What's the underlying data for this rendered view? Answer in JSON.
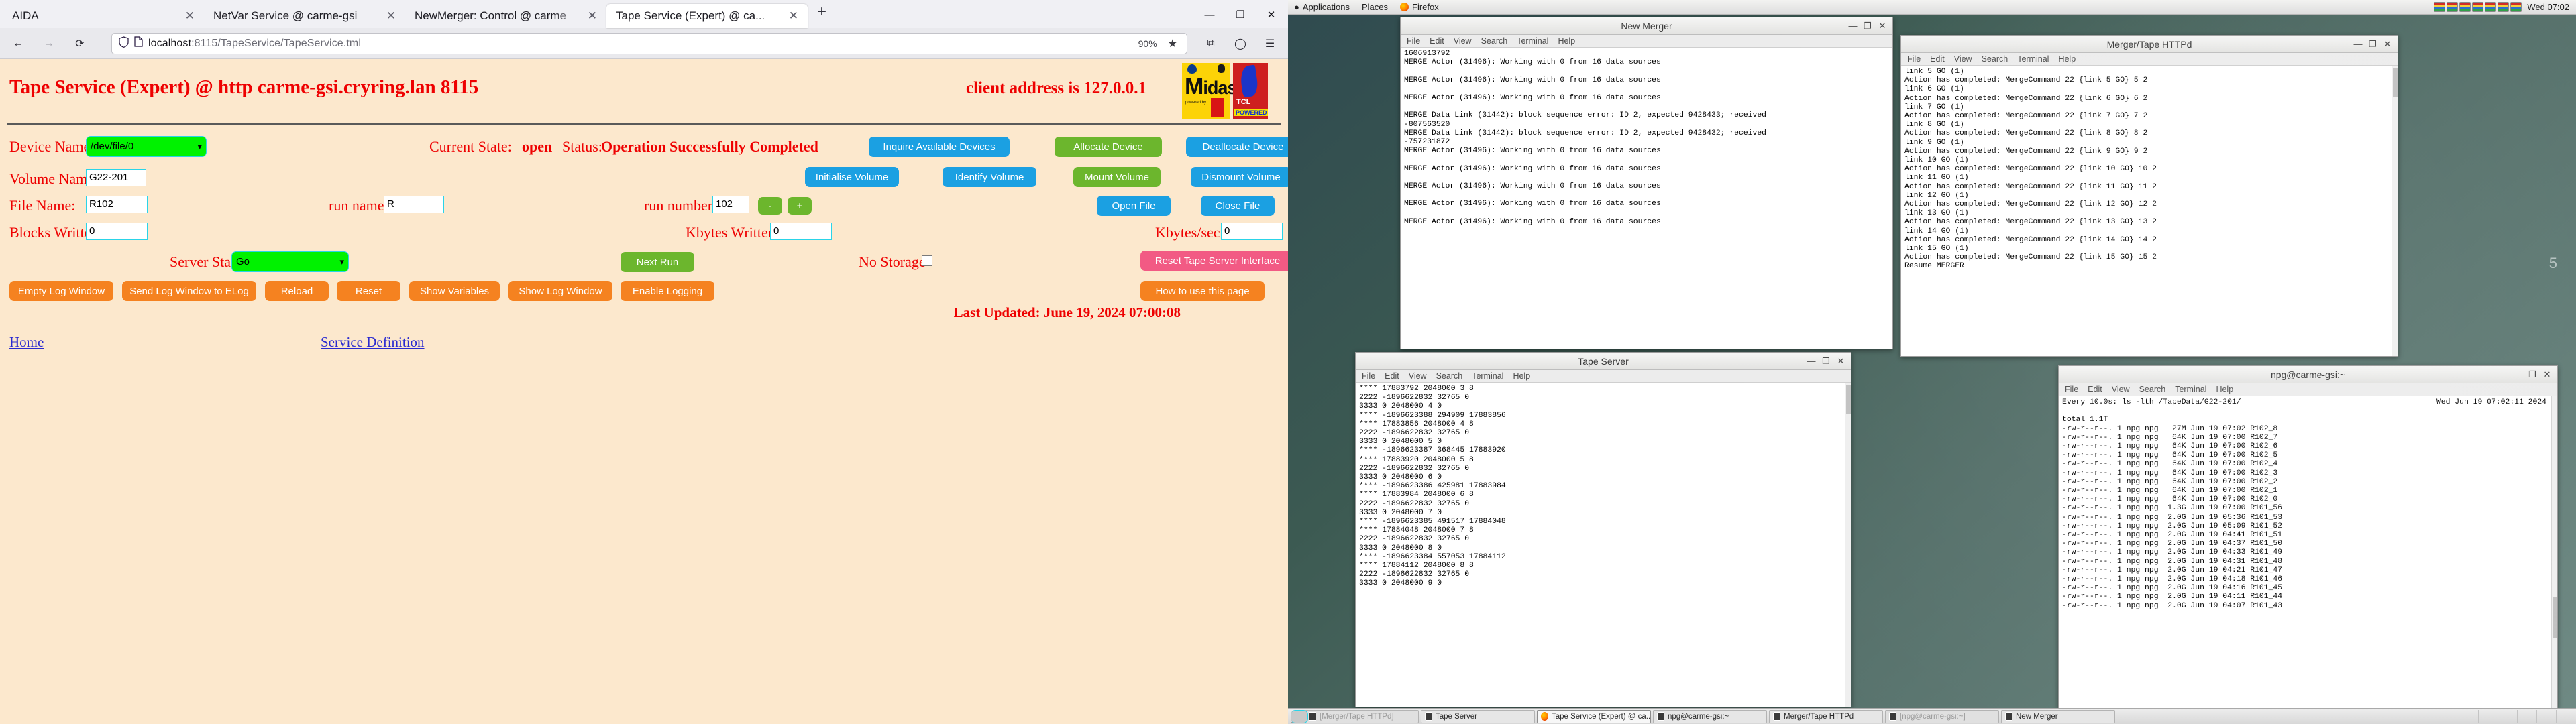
{
  "browser": {
    "tabs": [
      {
        "label": "AIDA",
        "active": false
      },
      {
        "label": "NetVar Service @ carme-gsi",
        "active": false
      },
      {
        "label": "NewMerger: Control @ carme",
        "active": false
      },
      {
        "label": "Tape Service (Expert) @ ca...",
        "active": true
      }
    ],
    "newtab_label": "+",
    "window_buttons": [
      "—",
      "❐",
      "✕"
    ],
    "nav": {
      "back": "←",
      "forward": "→",
      "reload": "⟳",
      "shield_icon": "shield",
      "page_icon": "page",
      "url_host": "localhost",
      "url_rest": ":8115/TapeService/TapeService.tml",
      "zoom": "90%",
      "bookmark_star": "★",
      "menu": "☰",
      "account": "◯",
      "extensions": "⧉"
    }
  },
  "page": {
    "title": "Tape Service (Expert) @ http carme-gsi.cryring.lan 8115",
    "client_address": "client address is 127.0.0.1",
    "logos": {
      "midas_word": "idas",
      "midas_m": "M",
      "midas_sub": "powered by",
      "tcl_line1": "TCL",
      "tcl_line2": "POWERED"
    },
    "fields": {
      "device_name_label": "Device Name:",
      "device_name_value": "/dev/file/0",
      "volume_name_label": "Volume Name:",
      "volume_name_value": "G22-201",
      "file_name_label": "File Name:",
      "file_name_value": "R102",
      "blocks_written_label": "Blocks Written:",
      "blocks_written_value": "0",
      "run_name_label": "run name:",
      "run_name_value": "R",
      "run_number_label": "run number:",
      "run_number_value": "102",
      "kbytes_written_label": "Kbytes Written:",
      "kbytes_written_value": "0",
      "kbytes_sec_label": "Kbytes/sec:",
      "kbytes_sec_value": "0",
      "server_state_label": "Server State",
      "server_state_value": "Go",
      "no_storage_label": "No Storage"
    },
    "status": {
      "current_state_label": "Current State:",
      "current_state_value": "open",
      "status_label": "Status:",
      "status_value": "Operation Successfully Completed"
    },
    "buttons": {
      "inquire_available_devices": "Inquire Available Devices",
      "allocate_device": "Allocate Device",
      "deallocate_device": "Deallocate Device",
      "initialise_volume": "Initialise Volume",
      "identify_volume": "Identify Volume",
      "mount_volume": "Mount Volume",
      "dismount_volume": "Dismount Volume",
      "open_file": "Open File",
      "close_file": "Close File",
      "next_run": "Next Run",
      "reset_tape_server_interface": "Reset Tape Server Interface",
      "empty_log_window": "Empty Log Window",
      "send_log_window_to_elog": "Send Log Window to ELog",
      "reload": "Reload",
      "reset": "Reset",
      "show_variables": "Show Variables",
      "show_log_window": "Show Log Window",
      "enable_logging": "Enable Logging",
      "how_to_use": "How to use this page",
      "minus": "-",
      "plus": "+"
    },
    "last_updated": "Last Updated: June 19, 2024 07:00:08",
    "footer_links": {
      "home": "Home",
      "service_definition": "Service Definition"
    }
  },
  "desktop": {
    "panel": {
      "applications": "Applications",
      "places": "Places",
      "firefox": "Firefox",
      "clock": "Wed 07:02"
    },
    "desktop_number": "5",
    "windows": [
      {
        "id": "new-merger",
        "title": "New Merger",
        "menu": [
          "File",
          "Edit",
          "View",
          "Search",
          "Terminal",
          "Help"
        ],
        "buttons": [
          "—",
          "❐",
          "✕"
        ],
        "content": "1606913792\nMERGE Actor (31496): Working with 0 from 16 data sources\n\nMERGE Actor (31496): Working with 0 from 16 data sources\n\nMERGE Actor (31496): Working with 0 from 16 data sources\n\nMERGE Data Link (31442): block sequence error: ID 2, expected 9428433; received\n-807563520\nMERGE Data Link (31442): block sequence error: ID 2, expected 9428432; received\n-757231872\nMERGE Actor (31496): Working with 0 from 16 data sources\n\nMERGE Actor (31496): Working with 0 from 16 data sources\n\nMERGE Actor (31496): Working with 0 from 16 data sources\n\nMERGE Actor (31496): Working with 0 from 16 data sources\n\nMERGE Actor (31496): Working with 0 from 16 data sources\n"
      },
      {
        "id": "merger-tape-httpd",
        "title": "Merger/Tape HTTPd",
        "menu": [
          "File",
          "Edit",
          "View",
          "Search",
          "Terminal",
          "Help"
        ],
        "buttons": [
          "—",
          "❐",
          "✕"
        ],
        "content": "link 5 GO (1)\nAction has completed: MergeCommand 22 {link 5 GO} 5 2\nlink 6 GO (1)\nAction has completed: MergeCommand 22 {link 6 GO} 6 2\nlink 7 GO (1)\nAction has completed: MergeCommand 22 {link 7 GO} 7 2\nlink 8 GO (1)\nAction has completed: MergeCommand 22 {link 8 GO} 8 2\nlink 9 GO (1)\nAction has completed: MergeCommand 22 {link 9 GO} 9 2\nlink 10 GO (1)\nAction has completed: MergeCommand 22 {link 10 GO} 10 2\nlink 11 GO (1)\nAction has completed: MergeCommand 22 {link 11 GO} 11 2\nlink 12 GO (1)\nAction has completed: MergeCommand 22 {link 12 GO} 12 2\nlink 13 GO (1)\nAction has completed: MergeCommand 22 {link 13 GO} 13 2\nlink 14 GO (1)\nAction has completed: MergeCommand 22 {link 14 GO} 14 2\nlink 15 GO (1)\nAction has completed: MergeCommand 22 {link 15 GO} 15 2\nResume MERGER"
      },
      {
        "id": "tape-server",
        "title": "Tape Server",
        "menu": [
          "File",
          "Edit",
          "View",
          "Search",
          "Terminal",
          "Help"
        ],
        "buttons": [
          "—",
          "❐",
          "✕"
        ],
        "content": "**** 17883792 2048000 3 8\n2222 -1896622832 32765 0\n3333 0 2048000 4 0\n**** -1896623388 294909 17883856\n**** 17883856 2048000 4 8\n2222 -1896622832 32765 0\n3333 0 2048000 5 0\n**** -1896623387 368445 17883920\n**** 17883920 2048000 5 8\n2222 -1896622832 32765 0\n3333 0 2048000 6 0\n**** -1896623386 425981 17883984\n**** 17883984 2048000 6 8\n2222 -1896622832 32765 0\n3333 0 2048000 7 0\n**** -1896623385 491517 17884048\n**** 17884048 2048000 7 8\n2222 -1896622832 32765 0\n3333 0 2048000 8 0\n**** -1896623384 557053 17884112\n**** 17884112 2048000 8 8\n2222 -1896622832 32765 0\n3333 0 2048000 9 0"
      },
      {
        "id": "npg-carme-gsi",
        "title": "npg@carme-gsi:~",
        "menu": [
          "File",
          "Edit",
          "View",
          "Search",
          "Terminal",
          "Help"
        ],
        "buttons": [
          "—",
          "❐",
          "✕"
        ],
        "content_left": "Every 10.0s: ls -lth /TapeData/G22-201/\n\ntotal 1.1T\n-rw-r--r--. 1 npg npg   27M Jun 19 07:02 R102_8\n-rw-r--r--. 1 npg npg   64K Jun 19 07:00 R102_7\n-rw-r--r--. 1 npg npg   64K Jun 19 07:00 R102_6\n-rw-r--r--. 1 npg npg   64K Jun 19 07:00 R102_5\n-rw-r--r--. 1 npg npg   64K Jun 19 07:00 R102_4\n-rw-r--r--. 1 npg npg   64K Jun 19 07:00 R102_3\n-rw-r--r--. 1 npg npg   64K Jun 19 07:00 R102_2\n-rw-r--r--. 1 npg npg   64K Jun 19 07:00 R102_1\n-rw-r--r--. 1 npg npg   64K Jun 19 07:00 R102_0\n-rw-r--r--. 1 npg npg  1.3G Jun 19 07:00 R101_56\n-rw-r--r--. 1 npg npg  2.0G Jun 19 05:36 R101_53\n-rw-r--r--. 1 npg npg  2.0G Jun 19 05:09 R101_52\n-rw-r--r--. 1 npg npg  2.0G Jun 19 04:41 R101_51\n-rw-r--r--. 1 npg npg  2.0G Jun 19 04:37 R101_50\n-rw-r--r--. 1 npg npg  2.0G Jun 19 04:33 R101_49\n-rw-r--r--. 1 npg npg  2.0G Jun 19 04:31 R101_48\n-rw-r--r--. 1 npg npg  2.0G Jun 19 04:21 R101_47\n-rw-r--r--. 1 npg npg  2.0G Jun 19 04:18 R101_46\n-rw-r--r--. 1 npg npg  2.0G Jun 19 04:16 R101_45\n-rw-r--r--. 1 npg npg  2.0G Jun 19 04:11 R101_44\n-rw-r--r--. 1 npg npg  2.0G Jun 19 04:07 R101_43",
        "header_right": "Wed Jun 19 07:02:11 2024"
      }
    ],
    "taskbar": [
      {
        "label": "[Merger/Tape HTTPd]",
        "state": "dim",
        "icon": "terminal-icon"
      },
      {
        "label": "Tape Server",
        "state": "normal",
        "icon": "terminal-icon"
      },
      {
        "label": "Tape Service (Expert) @ ca...",
        "state": "active",
        "icon": "firefox-icon"
      },
      {
        "label": "npg@carme-gsi:~",
        "state": "normal",
        "icon": "terminal-icon"
      },
      {
        "label": "Merger/Tape HTTPd",
        "state": "normal",
        "icon": "terminal-icon"
      },
      {
        "label": "[npg@carme-gsi:~]",
        "state": "dim",
        "icon": "terminal-icon"
      },
      {
        "label": "New Merger",
        "state": "normal",
        "icon": "terminal-icon"
      }
    ]
  }
}
